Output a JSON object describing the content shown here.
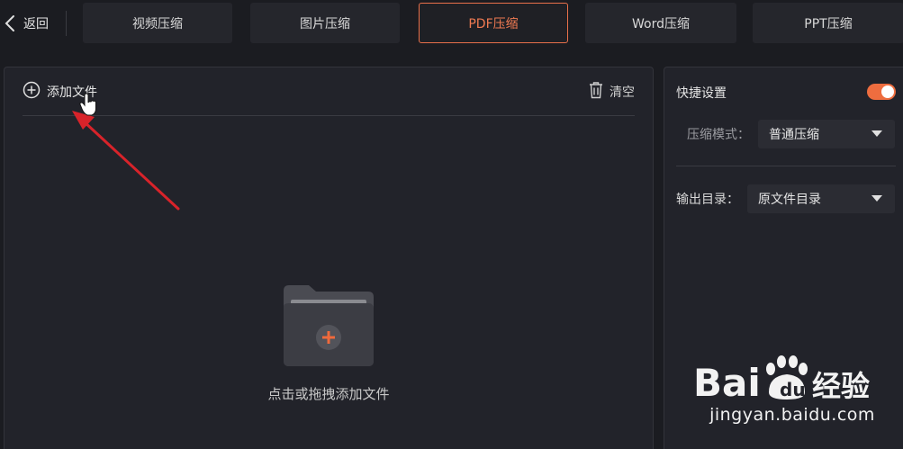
{
  "topbar": {
    "back_label": "返回",
    "tabs": [
      {
        "label": "视频压缩",
        "active": false
      },
      {
        "label": "图片压缩",
        "active": false
      },
      {
        "label": "PDF压缩",
        "active": true
      },
      {
        "label": "Word压缩",
        "active": false
      },
      {
        "label": "PPT压缩",
        "active": false
      }
    ]
  },
  "file_panel": {
    "add_label": "添加文件",
    "clear_label": "清空",
    "drop_hint": "点击或拖拽添加文件"
  },
  "settings": {
    "title": "快捷设置",
    "quick_enabled": true,
    "mode_label": "压缩模式：",
    "mode_value": "普通压缩",
    "output_label": "输出目录：",
    "output_value": "原文件目录"
  },
  "watermark": {
    "url": "jingyan.baidu.com"
  },
  "colors": {
    "accent": "#ee6d3f",
    "background": "#1b1c21",
    "panel": "#22232a",
    "annotation_arrow": "#d8232a"
  }
}
